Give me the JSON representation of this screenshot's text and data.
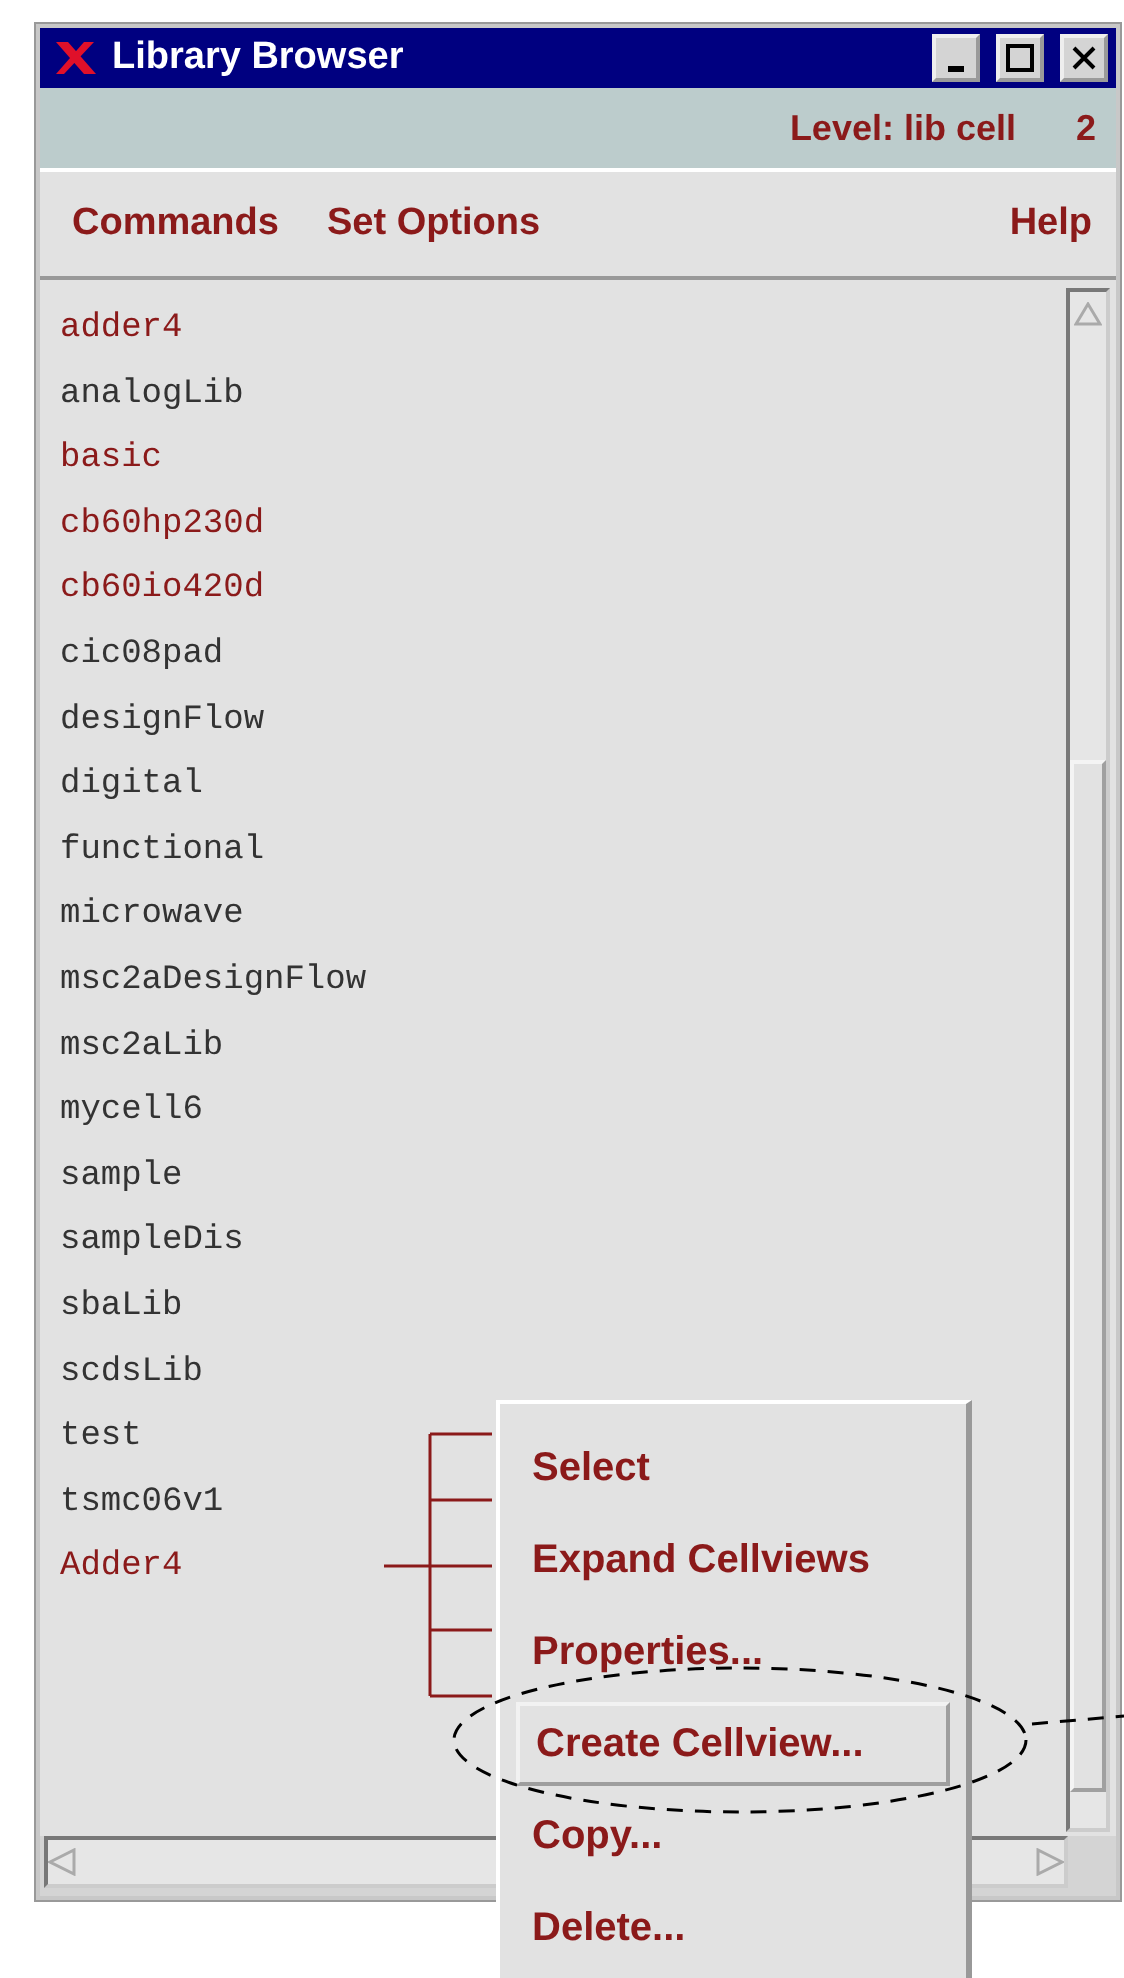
{
  "window": {
    "title": "Library Browser"
  },
  "level_bar": {
    "label": "Level: lib cell",
    "value": "2"
  },
  "menu_bar": {
    "left": [
      "Commands",
      "Set Options"
    ],
    "right": [
      "Help"
    ]
  },
  "libraries": [
    {
      "name": "adder4",
      "color": "#8b1a1a"
    },
    {
      "name": "analogLib",
      "color": "#333333"
    },
    {
      "name": "basic",
      "color": "#8b1a1a"
    },
    {
      "name": "cb60hp230d",
      "color": "#8b1a1a"
    },
    {
      "name": "cb60io420d",
      "color": "#8b1a1a"
    },
    {
      "name": "cic08pad",
      "color": "#333333"
    },
    {
      "name": "designFlow",
      "color": "#333333"
    },
    {
      "name": "digital",
      "color": "#333333"
    },
    {
      "name": "functional",
      "color": "#333333"
    },
    {
      "name": "microwave",
      "color": "#333333"
    },
    {
      "name": "msc2aDesignFlow",
      "color": "#333333"
    },
    {
      "name": "msc2aLib",
      "color": "#333333"
    },
    {
      "name": "mycell6",
      "color": "#333333"
    },
    {
      "name": "sample",
      "color": "#333333"
    },
    {
      "name": "sampleDis",
      "color": "#333333"
    },
    {
      "name": "sbaLib",
      "color": "#333333"
    },
    {
      "name": "scdsLib",
      "color": "#333333"
    },
    {
      "name": "test",
      "color": "#333333"
    },
    {
      "name": "tsmc06v1",
      "color": "#333333"
    },
    {
      "name": "Adder4",
      "color": "#8b1a1a"
    }
  ],
  "popup_menu": [
    {
      "label": "Select",
      "selected": false
    },
    {
      "label": "Expand Cellviews",
      "selected": false
    },
    {
      "label": "Properties...",
      "selected": false
    },
    {
      "label": "Create Cellview...",
      "selected": true
    },
    {
      "label": "Copy...",
      "selected": false
    },
    {
      "label": "Delete...",
      "selected": false
    }
  ]
}
